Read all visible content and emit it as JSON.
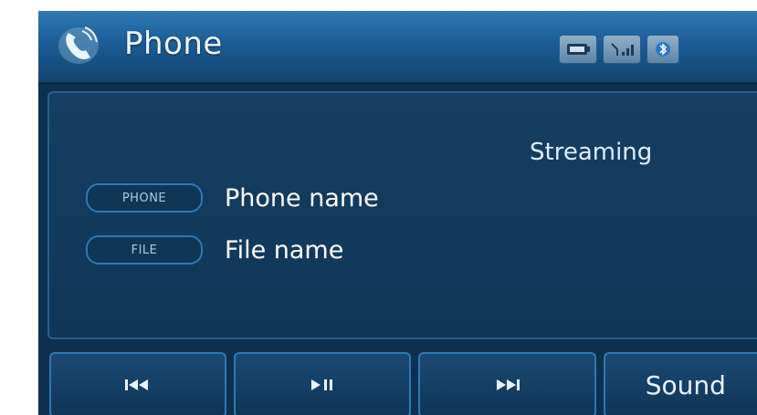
{
  "header": {
    "title": "Phone",
    "icons": [
      "phone-icon",
      "signal-icon",
      "battery-icon",
      "bluetooth-icon"
    ]
  },
  "panel": {
    "status": "Streaming",
    "rows": [
      {
        "tag": "PHONE",
        "value": "Phone name"
      },
      {
        "tag": "FILE",
        "value": "File name"
      }
    ]
  },
  "controls": {
    "buttons": [
      {
        "icon": "previous-icon"
      },
      {
        "icon": "play-pause-icon"
      },
      {
        "icon": "next-icon"
      },
      {
        "label": "Sound"
      }
    ]
  },
  "colors": {
    "header_blue": "#1c5d96",
    "panel_blue": "#123a5c",
    "accent": "#2f78b4"
  }
}
